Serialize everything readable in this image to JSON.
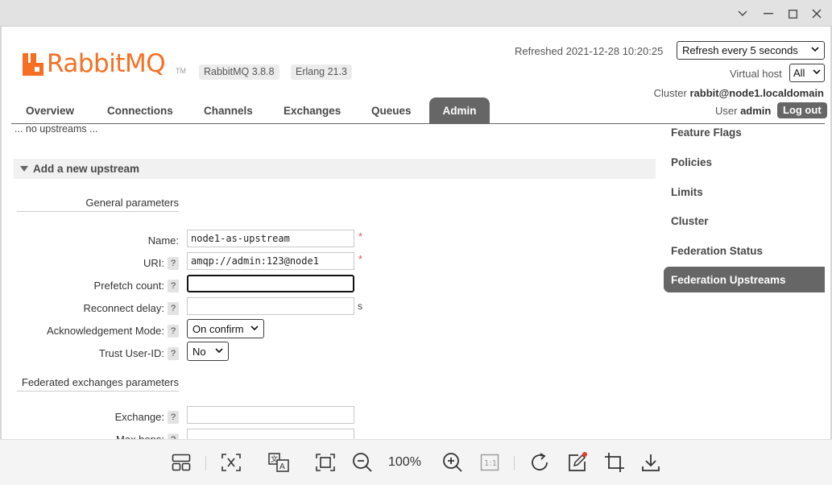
{
  "header": {
    "logo_text": "RabbitMQ",
    "logo_tm": "TM",
    "rabbitmq_version": "RabbitMQ 3.8.8",
    "erlang_version": "Erlang 21.3",
    "refreshed": "Refreshed 2021-12-28 10:20:25",
    "refresh_select": "Refresh every 5 seconds",
    "vhost_label": "Virtual host",
    "vhost_select": "All",
    "cluster_label": "Cluster",
    "cluster_name": "rabbit@node1.localdomain",
    "user_label": "User",
    "user_name": "admin",
    "logout_label": "Log out",
    "brand_color": "#f76f22"
  },
  "tabs": [
    {
      "label": "Overview"
    },
    {
      "label": "Connections"
    },
    {
      "label": "Channels"
    },
    {
      "label": "Exchanges"
    },
    {
      "label": "Queues"
    },
    {
      "label": "Admin"
    }
  ],
  "main": {
    "no_upstreams": "... no upstreams ...",
    "section_title": "Add a new upstream",
    "general_heading": "General parameters",
    "fields": {
      "name_label": "Name:",
      "name_value": "node1-as-upstream",
      "uri_label": "URI:",
      "uri_value": "amqp://admin:123@node1",
      "prefetch_label": "Prefetch count:",
      "prefetch_value": "",
      "reconnect_label": "Reconnect delay:",
      "reconnect_value": "",
      "reconnect_unit": "s",
      "ack_label": "Acknowledgement Mode:",
      "ack_value": "On confirm",
      "trust_label": "Trust User-ID:",
      "trust_value": "No",
      "required_mark": "*",
      "help_mark": "?"
    },
    "federated_heading": "Federated exchanges parameters",
    "exchange_label": "Exchange:",
    "exchange_value": "",
    "max_hops_label": "Max hops:"
  },
  "sidebar": {
    "items": [
      {
        "label": "Feature Flags"
      },
      {
        "label": "Policies"
      },
      {
        "label": "Limits"
      },
      {
        "label": "Cluster"
      },
      {
        "label": "Federation Status"
      },
      {
        "label": "Federation Upstreams"
      }
    ]
  },
  "toolbar": {
    "zoom_level": "100%",
    "icons": [
      "layout-icon",
      "close-frame-icon",
      "translate-icon",
      "fit-screen-icon",
      "zoom-out-icon",
      "zoom-in-icon",
      "actual-size-icon",
      "rotate-icon",
      "edit-icon",
      "crop-icon",
      "download-icon"
    ]
  }
}
